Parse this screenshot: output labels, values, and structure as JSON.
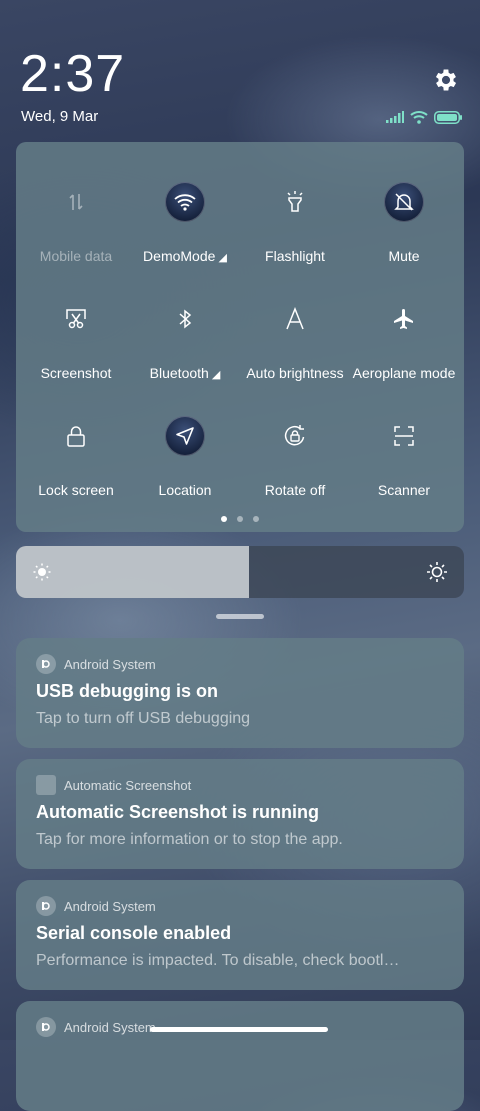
{
  "status": {
    "time": "2:37",
    "date": "Wed, 9 Mar"
  },
  "quick_settings": {
    "tiles": [
      {
        "label": "Mobile data",
        "icon": "mobile-data-icon",
        "state": "disabled"
      },
      {
        "label": "DemoMode",
        "icon": "wifi-icon",
        "state": "active"
      },
      {
        "label": "Flashlight",
        "icon": "flashlight-icon",
        "state": "off"
      },
      {
        "label": "Mute",
        "icon": "mute-bell-icon",
        "state": "active"
      },
      {
        "label": "Screenshot",
        "icon": "screenshot-icon",
        "state": "off"
      },
      {
        "label": "Bluetooth",
        "icon": "bluetooth-icon",
        "state": "off"
      },
      {
        "label": "Auto brightness",
        "icon": "auto-brightness-icon",
        "state": "off"
      },
      {
        "label": "Aeroplane mode",
        "icon": "aeroplane-icon",
        "state": "off"
      },
      {
        "label": "Lock screen",
        "icon": "lock-icon",
        "state": "off"
      },
      {
        "label": "Location",
        "icon": "location-icon",
        "state": "active"
      },
      {
        "label": "Rotate off",
        "icon": "rotate-icon",
        "state": "off"
      },
      {
        "label": "Scanner",
        "icon": "scanner-icon",
        "state": "off"
      }
    ],
    "page_count": 3,
    "current_page": 1
  },
  "brightness": {
    "level_percent": 52
  },
  "notifications": [
    {
      "app": "Android System",
      "title": "USB debugging is on",
      "body": "Tap to turn off USB debugging"
    },
    {
      "app": "Automatic Screenshot",
      "title": "Automatic Screenshot is running",
      "body": "Tap for more information or to stop the app."
    },
    {
      "app": "Android System",
      "title": "Serial console enabled",
      "body": "Performance is impacted. To disable, check bootl…"
    },
    {
      "app": "Android System",
      "title": "",
      "body": ""
    }
  ],
  "colors": {
    "panel": "#647d87",
    "active_tile": "#14203a",
    "battery": "#7fe0c8"
  }
}
